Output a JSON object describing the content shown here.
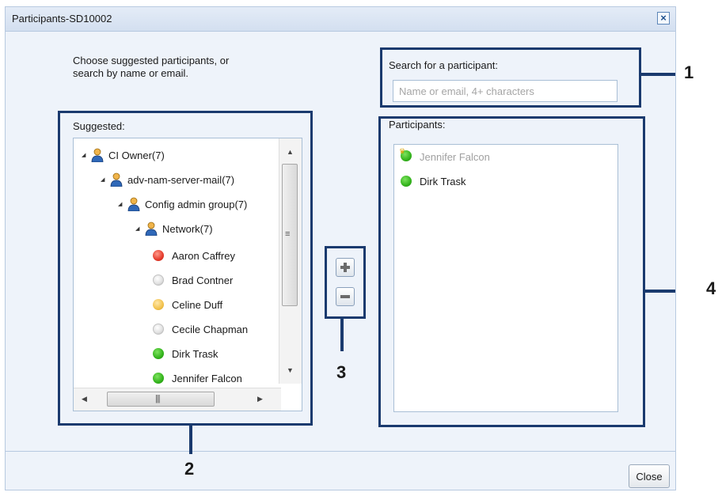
{
  "dialog": {
    "title": "Participants-SD10002",
    "close_icon": "close-x-icon",
    "close_button": "Close"
  },
  "instruction": {
    "line1": "Choose suggested participants, or",
    "line2": "search by name or email."
  },
  "search": {
    "label": "Search for a participant:",
    "placeholder": "Name or email, 4+ characters"
  },
  "suggested": {
    "label": "Suggested:",
    "groups": [
      {
        "label": "CI Owner(7)"
      },
      {
        "label": "adv-nam-server-mail(7)"
      },
      {
        "label": "Config admin group(7)"
      },
      {
        "label": "Network(7)"
      }
    ],
    "people": [
      {
        "name": "Aaron Caffrey",
        "status": "red"
      },
      {
        "name": "Brad Contner",
        "status": "grey"
      },
      {
        "name": "Celine Duff",
        "status": "yellow"
      },
      {
        "name": "Cecile Chapman",
        "status": "grey"
      },
      {
        "name": "Dirk Trask",
        "status": "green"
      },
      {
        "name": "Jennifer Falcon",
        "status": "green"
      }
    ]
  },
  "participants": {
    "label": "Participants:",
    "items": [
      {
        "name": "Jennifer Falcon",
        "owner": true
      },
      {
        "name": "Dirk Trask",
        "owner": false
      }
    ]
  },
  "callouts": {
    "one": "1",
    "two": "2",
    "three": "3",
    "four": "4"
  },
  "colors": {
    "callout_border": "#1a3a6e",
    "dialog_bg": "#eef3fa"
  }
}
